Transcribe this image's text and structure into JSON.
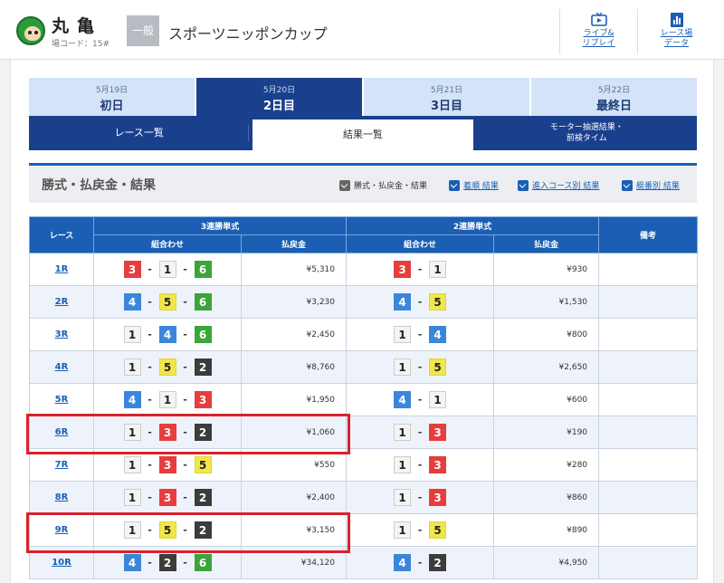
{
  "header": {
    "venue_name": "丸亀",
    "venue_code": "場コード：15#",
    "grade": "一般",
    "race_title": "スポーツニッポンカップ",
    "links": [
      {
        "label1": "ライブ&",
        "label2": "リプレイ",
        "icon": "tv-icon"
      },
      {
        "label1": "レース場",
        "label2": "データ",
        "icon": "bar-chart-icon"
      }
    ]
  },
  "day_tabs": [
    {
      "date": "5月19日",
      "day": "初日",
      "active": false
    },
    {
      "date": "5月20日",
      "day": "2日目",
      "active": true
    },
    {
      "date": "5月21日",
      "day": "3日目",
      "active": false
    },
    {
      "date": "5月22日",
      "day": "最終日",
      "active": false
    }
  ],
  "sub_nav": {
    "race_list": "レース一覧",
    "results_list": "結果一覧",
    "motor_line1": "モーター抽選結果・",
    "motor_line2": "前検タイム"
  },
  "section": {
    "title": "勝式・払戻金・結果",
    "chips": [
      "勝式・払戻金・結果",
      "着順 結果",
      "進入コース別 結果",
      "艇番別 結果"
    ]
  },
  "table": {
    "headers": {
      "race": "レース",
      "trifecta": "3連勝単式",
      "exacta": "2連勝単式",
      "remarks": "備考",
      "combo": "組合わせ",
      "payout": "払戻金"
    },
    "rows": [
      {
        "race": "1R",
        "tri": [
          3,
          1,
          6
        ],
        "tri_pay": "¥5,310",
        "ex": [
          3,
          1
        ],
        "ex_pay": "¥930"
      },
      {
        "race": "2R",
        "tri": [
          4,
          5,
          6
        ],
        "tri_pay": "¥3,230",
        "ex": [
          4,
          5
        ],
        "ex_pay": "¥1,530"
      },
      {
        "race": "3R",
        "tri": [
          1,
          4,
          6
        ],
        "tri_pay": "¥2,450",
        "ex": [
          1,
          4
        ],
        "ex_pay": "¥800"
      },
      {
        "race": "4R",
        "tri": [
          1,
          5,
          2
        ],
        "tri_pay": "¥8,760",
        "ex": [
          1,
          5
        ],
        "ex_pay": "¥2,650"
      },
      {
        "race": "5R",
        "tri": [
          4,
          1,
          3
        ],
        "tri_pay": "¥1,950",
        "ex": [
          4,
          1
        ],
        "ex_pay": "¥600"
      },
      {
        "race": "6R",
        "tri": [
          1,
          3,
          2
        ],
        "tri_pay": "¥1,060",
        "ex": [
          1,
          3
        ],
        "ex_pay": "¥190"
      },
      {
        "race": "7R",
        "tri": [
          1,
          3,
          5
        ],
        "tri_pay": "¥550",
        "ex": [
          1,
          3
        ],
        "ex_pay": "¥280"
      },
      {
        "race": "8R",
        "tri": [
          1,
          3,
          2
        ],
        "tri_pay": "¥2,400",
        "ex": [
          1,
          3
        ],
        "ex_pay": "¥860"
      },
      {
        "race": "9R",
        "tri": [
          1,
          5,
          2
        ],
        "tri_pay": "¥3,150",
        "ex": [
          1,
          5
        ],
        "ex_pay": "¥890"
      },
      {
        "race": "10R",
        "tri": [
          4,
          2,
          6
        ],
        "tri_pay": "¥34,120",
        "ex": [
          4,
          2
        ],
        "ex_pay": "¥4,950"
      }
    ]
  },
  "colors": {
    "navy": "#1a3f8d",
    "blue": "#1a5fb4",
    "highlight": "#d9212b"
  }
}
